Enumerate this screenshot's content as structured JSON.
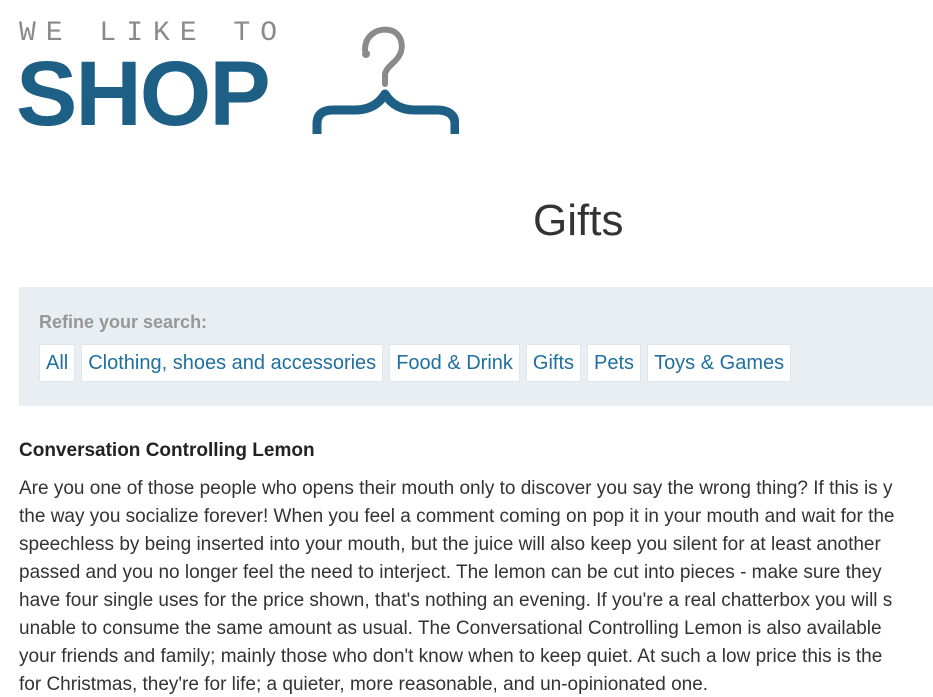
{
  "logo": {
    "tagline": "WE LIKE TO",
    "wordmark": "SHOP",
    "colors": {
      "wordmark": "#1e5f86",
      "tagline": "#8a8a8a",
      "hanger_hook": "#8a8a8a"
    }
  },
  "page": {
    "title": "Gifts"
  },
  "filters": {
    "heading": "Refine your search:",
    "items": [
      {
        "label": "All"
      },
      {
        "label": "Clothing, shoes and accessories"
      },
      {
        "label": "Food & Drink"
      },
      {
        "label": "Gifts"
      },
      {
        "label": "Pets"
      },
      {
        "label": "Toys & Games"
      }
    ],
    "colors": {
      "background": "#e8eef1",
      "link": "#1f6f9f"
    }
  },
  "product": {
    "name": "Conversation Controlling Lemon",
    "description_lines": [
      "Are you one of those people who opens their mouth only to discover you say the wrong thing? If this is y",
      "the way you socialize forever! When you feel a comment coming on pop it in your mouth and wait for the",
      "speechless by being inserted into your mouth, but the juice will also keep you silent for at least another",
      "passed and you no longer feel the need to interject. The lemon can be cut into pieces - make sure they",
      "have four single uses for the price shown, that's nothing an evening. If you're a real chatterbox you will s",
      "unable to consume the same amount as usual. The Conversational Controlling Lemon is also available",
      "your friends and family; mainly those who don't know when to keep quiet. At such a low price this is the",
      "for Christmas, they're for life; a quieter, more reasonable, and un-opinionated one."
    ]
  }
}
